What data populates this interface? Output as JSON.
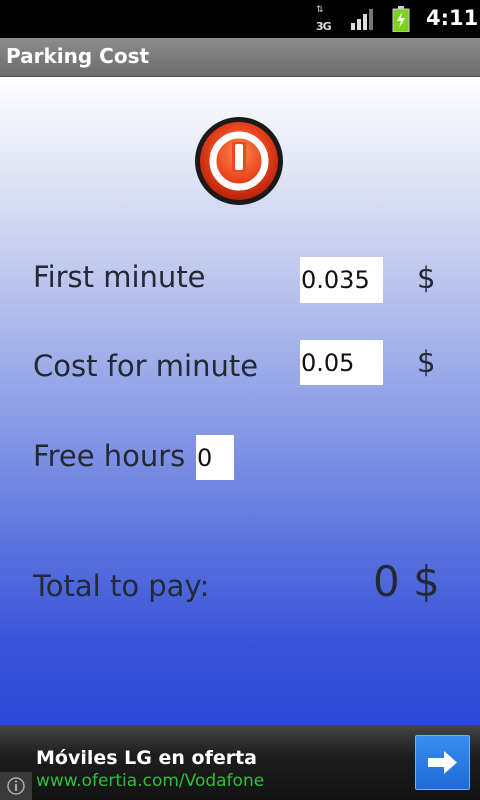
{
  "status_bar": {
    "network_type": "3G",
    "time": "4:11"
  },
  "app": {
    "title": "Parking Cost"
  },
  "form": {
    "first_minute_label": "First minute",
    "first_minute_value": "0.035",
    "first_minute_currency": "$",
    "cost_per_minute_label": "Cost for minute",
    "cost_per_minute_value": "0.05",
    "cost_per_minute_currency": "$",
    "free_hours_label": "Free hours",
    "free_hours_value": "0"
  },
  "total": {
    "label": "Total to pay:",
    "value": "0 $"
  },
  "ad": {
    "headline": "Móviles LG en oferta",
    "url": "www.ofertia.com/Vodafone"
  },
  "colors": {
    "power_button": "#e8401c",
    "ad_url": "#2fbe3a",
    "ad_button": "#2a7be6"
  }
}
